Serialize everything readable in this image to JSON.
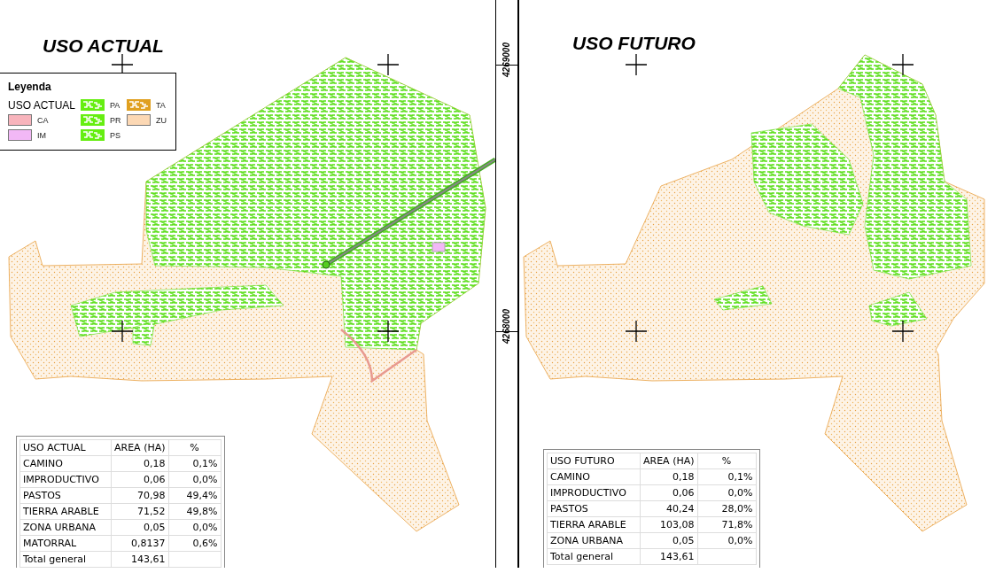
{
  "maps": [
    {
      "title": "USO ACTUAL",
      "legend": {
        "title": "Leyenda",
        "layer": "USO ACTUAL",
        "items": [
          {
            "label": "CA",
            "kind": "solid",
            "color": "#f8b4bc"
          },
          {
            "label": "IM",
            "kind": "solid",
            "color": "#f2b8f6"
          },
          {
            "label": "PA",
            "kind": "pattern",
            "color": "#66ee11"
          },
          {
            "label": "PR",
            "kind": "pattern",
            "color": "#66ee11"
          },
          {
            "label": "PS",
            "kind": "pattern",
            "color": "#66ee11"
          },
          {
            "label": "TA",
            "kind": "pattern",
            "color": "#e0a020"
          },
          {
            "label": "ZU",
            "kind": "solid",
            "color": "#fcd8b4"
          }
        ]
      },
      "table": {
        "rows": [
          [
            "USO ACTUAL",
            "AREA  (HA)",
            "%"
          ],
          [
            "CAMINO",
            "0,18",
            "0,1%"
          ],
          [
            "IMPRODUCTIVO",
            "0,06",
            "0,0%"
          ],
          [
            "PASTOS",
            "70,98",
            "49,4%"
          ],
          [
            "TIERRA ARABLE",
            "71,52",
            "49,8%"
          ],
          [
            "ZONA URBANA",
            "0,05",
            "0,0%"
          ],
          [
            "MATORRAL",
            "0,8137",
            "0,6%"
          ],
          [
            "Total general",
            "143,61"
          ]
        ]
      }
    },
    {
      "title": "USO FUTURO",
      "table": {
        "rows": [
          [
            "USO FUTURO",
            "AREA  (HA)",
            "%"
          ],
          [
            "CAMINO",
            "0,18",
            "0,1%"
          ],
          [
            "IMPRODUCTIVO",
            "0,06",
            "0,0%"
          ],
          [
            "PASTOS",
            "40,24",
            "28,0%"
          ],
          [
            "TIERRA ARABLE",
            "103,08",
            "71,8%"
          ],
          [
            "ZONA URBANA",
            "0,05",
            "0,0%"
          ],
          [
            "Total general",
            "143,61"
          ]
        ]
      }
    }
  ],
  "axis_labels": [
    "4269000",
    "4268000"
  ]
}
